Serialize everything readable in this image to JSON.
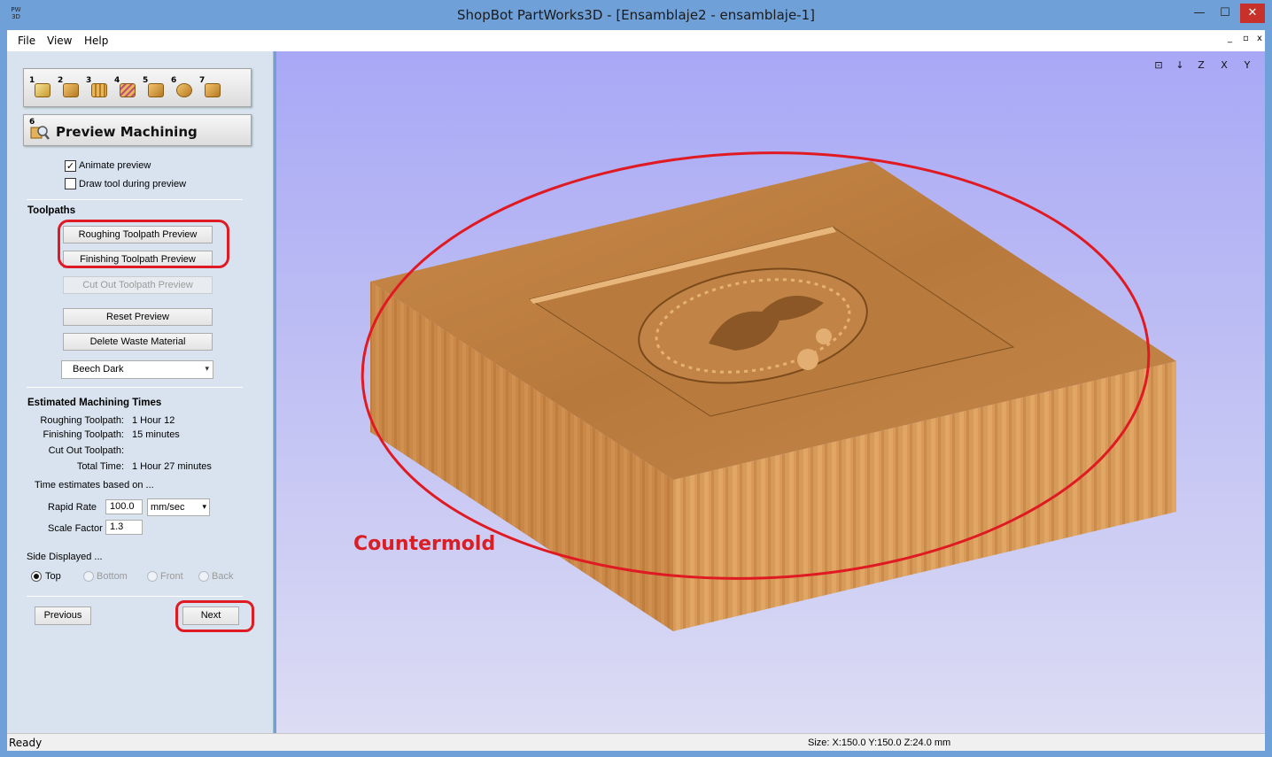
{
  "window": {
    "app_icon_text": "PW 3D",
    "title": "ShopBot PartWorks3D - [Ensamblaje2 - ensamblaje-1]",
    "minimize": "—",
    "maximize": "☐",
    "close": "✕"
  },
  "menu": {
    "items": [
      "File",
      "View",
      "Help"
    ],
    "mdi_controls": [
      "_",
      "▫",
      "x"
    ]
  },
  "toolbar": {
    "steps": [
      "1",
      "2",
      "3",
      "4",
      "5",
      "6",
      "7"
    ]
  },
  "panel": {
    "header_title": "Preview Machining",
    "header_step": "6",
    "animate_preview": {
      "label": "Animate preview",
      "checked": true,
      "mark": "✓"
    },
    "draw_tool": {
      "label": "Draw tool during preview",
      "checked": false
    },
    "toolpaths_heading": "Toolpaths",
    "roughing_button": "Roughing Toolpath Preview",
    "finishing_button": "Finishing Toolpath Preview",
    "cutout_button": "Cut Out Toolpath Preview",
    "reset_button": "Reset Preview",
    "delete_waste_button": "Delete Waste Material",
    "material_select": "Beech Dark",
    "times_heading": "Estimated Machining Times",
    "times": [
      {
        "label": "Roughing Toolpath:",
        "value": "1 Hour 12"
      },
      {
        "label": "Finishing Toolpath:",
        "value": "15 minutes"
      },
      {
        "label": "Cut Out Toolpath:",
        "value": ""
      },
      {
        "label": "Total Time:",
        "value": "1 Hour 27 minutes"
      }
    ],
    "time_based_on": "Time estimates based on ...",
    "rapid_rate_label": "Rapid Rate",
    "rapid_rate_value": "100.0",
    "rapid_rate_unit": "mm/sec",
    "scale_factor_label": "Scale Factor",
    "scale_factor_value": "1.3",
    "side_heading": "Side Displayed ...",
    "sides": [
      {
        "label": "Top",
        "selected": true,
        "enabled": true
      },
      {
        "label": "Bottom",
        "selected": false,
        "enabled": false
      },
      {
        "label": "Front",
        "selected": false,
        "enabled": false
      },
      {
        "label": "Back",
        "selected": false,
        "enabled": false
      }
    ],
    "previous_button": "Previous",
    "next_button": "Next"
  },
  "viewport": {
    "annotation": "Countermold",
    "view_tools": [
      "iso-view-icon",
      "axis-view-icon",
      "z-view-icon",
      "x-view-icon",
      "y-view-icon"
    ],
    "view_tool_labels": [
      "⊡",
      "↓",
      "Z",
      "X",
      "Y"
    ],
    "accent_red": "#e01a22"
  },
  "status": {
    "left": "Ready",
    "size": "Size: X:150.0 Y:150.0 Z:24.0 mm"
  }
}
